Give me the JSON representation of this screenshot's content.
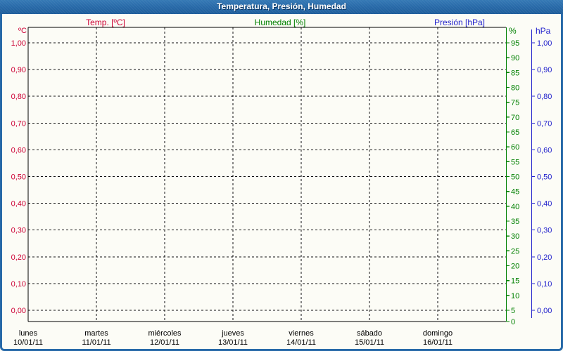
{
  "window": {
    "title": "Temperatura, Presión, Humedad"
  },
  "legend": {
    "temp": "Temp. [ºC]",
    "humidity": "Humedad [%]",
    "pressure": "Presión [hPa]"
  },
  "colors": {
    "temp": "#cc0033",
    "humidity": "#008000",
    "pressure": "#2222cc",
    "frame_blue": "#2769a8",
    "grid": "#111111",
    "plot_border": "#000000",
    "background": "#fcfcf6",
    "title_text": "#ffffff"
  },
  "chart_data": {
    "type": "line",
    "title": "Temperatura, Presión, Humedad",
    "empty": true,
    "series": [
      {
        "name": "Temp. [ºC]",
        "unit": "ºC",
        "color": "#cc0033",
        "axis": "left",
        "values": []
      },
      {
        "name": "Humedad [%]",
        "unit": "%",
        "color": "#008000",
        "axis": "right_inner",
        "values": []
      },
      {
        "name": "Presión [hPa]",
        "unit": "hPa",
        "color": "#2222cc",
        "axis": "right_outer",
        "values": []
      }
    ],
    "axes": {
      "left": {
        "unit": "ºC",
        "color": "#cc0033",
        "min": 0,
        "max": 1,
        "step": 0.1,
        "tick_labels_top_to_bottom": [
          "1,00",
          "0,90",
          "0,80",
          "0,70",
          "0,60",
          "0,50",
          "0,40",
          "0,30",
          "0,20",
          "0,10",
          "0,00"
        ]
      },
      "right_inner": {
        "unit": "%",
        "color": "#008000",
        "min": 0,
        "max": 100,
        "step": 5,
        "tick_labels_top_to_bottom": [
          "95",
          "90",
          "85",
          "80",
          "75",
          "70",
          "65",
          "60",
          "55",
          "50",
          "45",
          "40",
          "35",
          "30",
          "25",
          "20",
          "15",
          "10",
          "5",
          "0"
        ]
      },
      "right_outer": {
        "unit": "hPa",
        "color": "#2222cc",
        "min": 0,
        "max": 1,
        "step": 0.1,
        "tick_labels_top_to_bottom": [
          "1,00",
          "0,90",
          "0,80",
          "0,70",
          "0,60",
          "0,50",
          "0,40",
          "0,30",
          "0,20",
          "0,10",
          "0,00"
        ]
      }
    },
    "x_axis": {
      "days": [
        {
          "name": "lunes",
          "date": "10/01/11"
        },
        {
          "name": "martes",
          "date": "11/01/11"
        },
        {
          "name": "miércoles",
          "date": "12/01/11"
        },
        {
          "name": "jueves",
          "date": "13/01/11"
        },
        {
          "name": "viernes",
          "date": "14/01/11"
        },
        {
          "name": "sábado",
          "date": "15/01/11"
        },
        {
          "name": "domingo",
          "date": "16/01/11"
        }
      ]
    },
    "grid": {
      "style": "dashed",
      "horizontal_lines": 11,
      "vertical_lines": 6
    }
  }
}
